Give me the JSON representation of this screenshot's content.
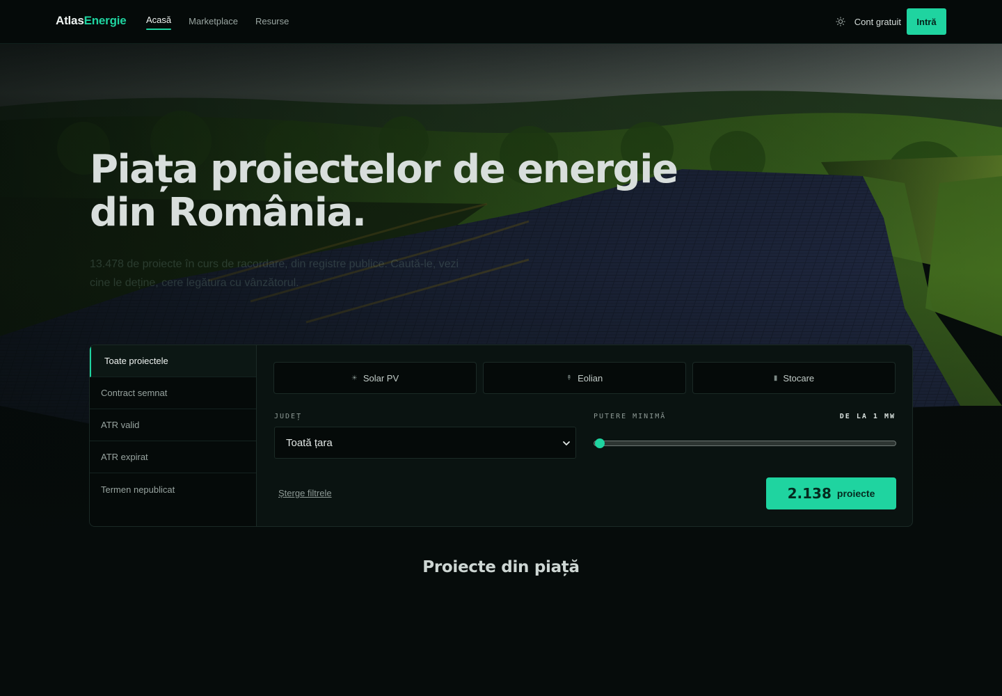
{
  "nav": {
    "logo_part1": "Atlas",
    "logo_part2": "Energie",
    "links": [
      {
        "label": "Acasă",
        "active": true
      },
      {
        "label": "Marketplace",
        "active": false
      },
      {
        "label": "Resurse",
        "active": false
      }
    ],
    "theme_icon": "sun-icon",
    "cont_label": "Cont gratuit",
    "login_label": "Intră"
  },
  "hero": {
    "title_line1": "Piața proiectelor de energie",
    "title_line2": "din România.",
    "subtitle": "13.478 de proiecte în curs de racordare, din registre publice. Caută-le, vezi cine le deține, cere legătura cu vânzătorul."
  },
  "filters": {
    "status_items": [
      {
        "label": "Toate proiectele",
        "active": true
      },
      {
        "label": "Contract semnat",
        "active": false
      },
      {
        "label": "ATR valid",
        "active": false
      },
      {
        "label": "ATR expirat",
        "active": false
      },
      {
        "label": "Termen nepublicat",
        "active": false
      }
    ],
    "types": [
      {
        "label": "Solar PV",
        "icon": "sun-icon",
        "glyph": "☀"
      },
      {
        "label": "Eolian",
        "icon": "wind-turbine-icon",
        "glyph": "↟"
      },
      {
        "label": "Stocare",
        "icon": "battery-icon",
        "glyph": "▮"
      }
    ],
    "judet_label": "JUDEȚ",
    "judet_value": "Toată țara",
    "putere_label": "PUTERE MINIMĂ",
    "putere_value_label": "DE LA 1 MW",
    "putere_min_mw": 1,
    "clear_label": "Șterge filtrele",
    "count_value": "2.138",
    "count_label": "proiecte"
  },
  "section": {
    "title": "Proiecte din piață"
  },
  "colors": {
    "accent": "#1fd4a0",
    "background": "#060c0b",
    "panel": "#0a1311"
  }
}
